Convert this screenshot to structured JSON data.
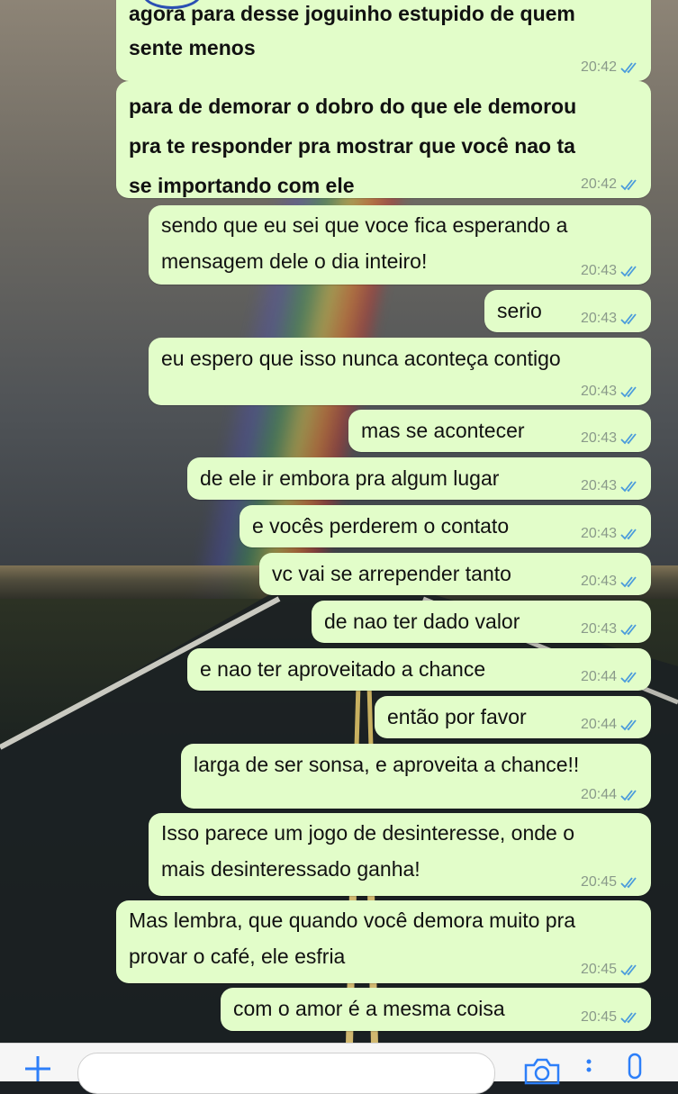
{
  "messages": [
    {
      "lines": [
        "agora para desse joguinho estupido de quem",
        "sente menos"
      ],
      "time": "20:42",
      "bold": true
    },
    {
      "lines": [
        "para de demorar o dobro do que ele demorou",
        "pra te responder pra mostrar que você nao ta",
        "se importando com ele"
      ],
      "time": "20:42",
      "bold": true
    },
    {
      "lines": [
        "sendo que eu sei que voce fica esperando a",
        "mensagem dele o dia inteiro!"
      ],
      "time": "20:43",
      "bold": false
    },
    {
      "lines": [
        "serio"
      ],
      "time": "20:43",
      "bold": false
    },
    {
      "lines": [
        "eu espero que isso nunca aconteça contigo"
      ],
      "time": "20:43",
      "bold": false
    },
    {
      "lines": [
        "mas se acontecer"
      ],
      "time": "20:43",
      "bold": false
    },
    {
      "lines": [
        "de ele ir embora pra algum lugar"
      ],
      "time": "20:43",
      "bold": false
    },
    {
      "lines": [
        "e vocês perderem o contato"
      ],
      "time": "20:43",
      "bold": false
    },
    {
      "lines": [
        "vc vai se arrepender tanto"
      ],
      "time": "20:43",
      "bold": false
    },
    {
      "lines": [
        "de nao ter dado valor"
      ],
      "time": "20:43",
      "bold": false
    },
    {
      "lines": [
        "e nao ter aproveitado a chance"
      ],
      "time": "20:44",
      "bold": false
    },
    {
      "lines": [
        "então por favor"
      ],
      "time": "20:44",
      "bold": false
    },
    {
      "lines": [
        "larga de ser sonsa, e aproveita a chance!!"
      ],
      "time": "20:44",
      "bold": false
    },
    {
      "lines": [
        "Isso parece um jogo de desinteresse, onde o",
        "mais desinteressado ganha!"
      ],
      "time": "20:45",
      "bold": false
    },
    {
      "lines": [
        "Mas lembra, que quando você demora muito pra",
        "provar o café, ele esfria"
      ],
      "time": "20:45",
      "bold": false
    },
    {
      "lines": [
        "com o amor é a mesma coisa"
      ],
      "time": "20:45",
      "bold": false
    }
  ],
  "status_icon": "double-check-icon",
  "colors": {
    "bubble": "#e2fdc9",
    "read_ticks": "#4a9bdc",
    "time_text": "#8a9a8a"
  },
  "input_bar": {
    "icons": [
      "plus-icon",
      "camera-icon",
      "more-icon",
      "microphone-icon"
    ]
  }
}
